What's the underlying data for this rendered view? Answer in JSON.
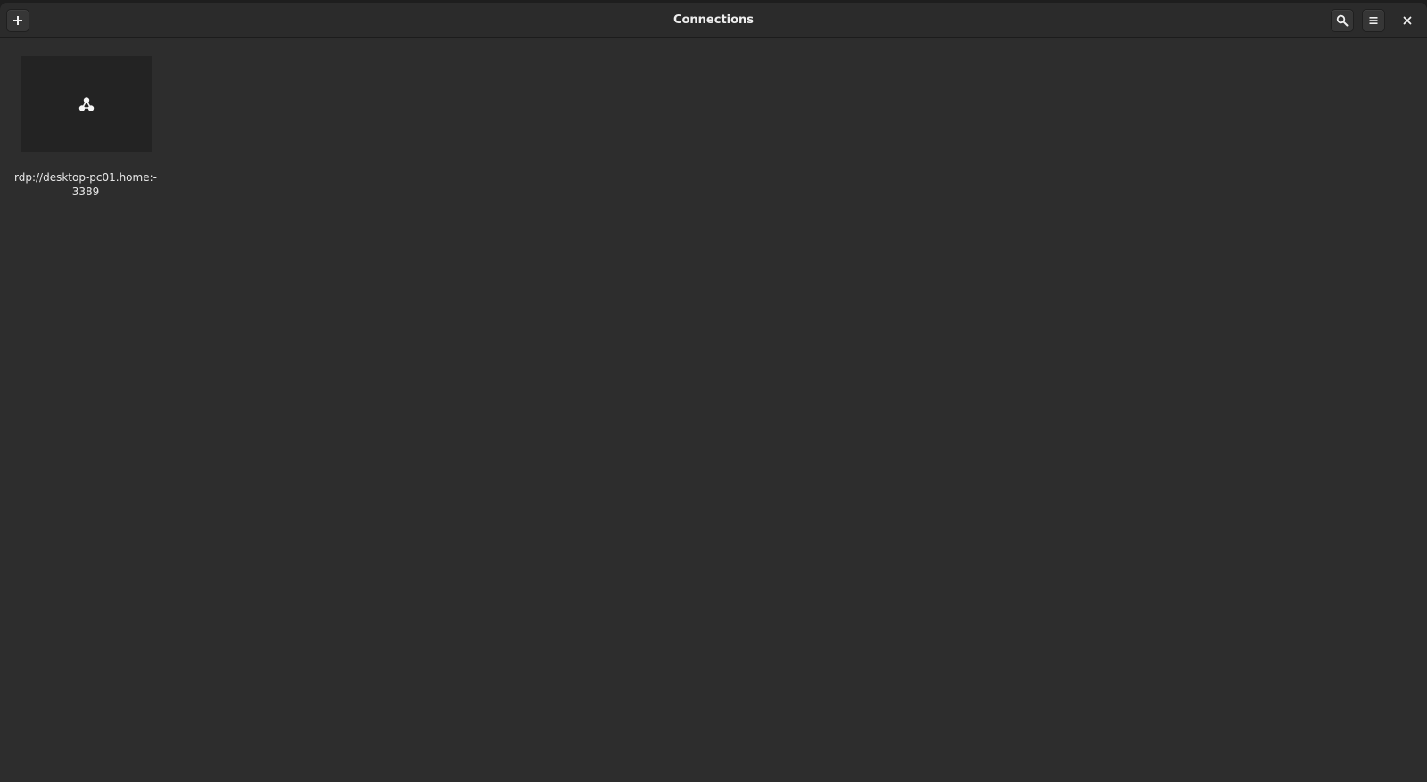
{
  "window": {
    "title": "Connections"
  },
  "headerbar": {
    "add_icon": "plus-icon",
    "search_icon": "search-icon",
    "menu_icon": "hamburger-menu-icon",
    "close_icon": "close-icon"
  },
  "connections": [
    {
      "icon": "network-connection-icon",
      "label_line1": "rdp://desktop-pc01.home:-",
      "label_line2": "3389"
    }
  ],
  "colors": {
    "background": "#2d2d2d",
    "headerbar": "#2b2b2b",
    "thumbnail": "#232323",
    "text": "#eeeeee"
  }
}
